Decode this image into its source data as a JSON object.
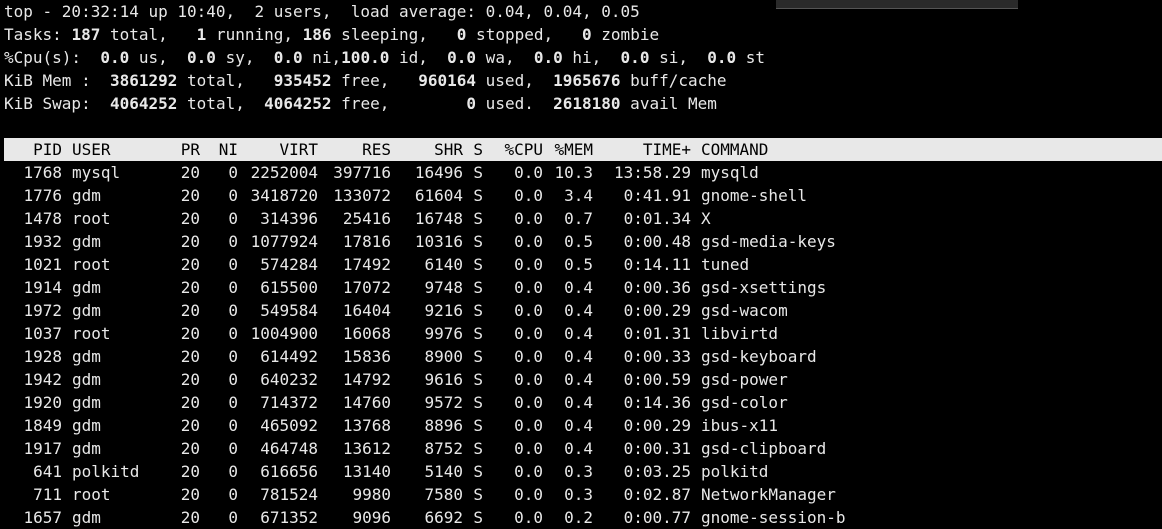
{
  "colors": {
    "background": "#000000",
    "foreground": "#e8e8e8",
    "header_bg": "#e8e8e8",
    "header_fg": "#000000"
  },
  "summary": {
    "line1": "top - 20:32:14 up 10:40,  2 users,  load average: 0.04, 0.04, 0.05",
    "tasks": {
      "prefix": "Tasks: ",
      "total": "187",
      "total_label": " total,   ",
      "running": "1",
      "running_label": " running, ",
      "sleeping": "186",
      "sleeping_label": " sleeping,   ",
      "stopped": "0",
      "stopped_label": " stopped,   ",
      "zombie": "0",
      "zombie_label": " zombie"
    },
    "cpu": {
      "prefix": "%Cpu(s): ",
      "us": " 0.0",
      "us_label": " us,  ",
      "sy": "0.0",
      "sy_label": " sy,  ",
      "ni": "0.0",
      "ni_label": " ni,",
      "id": "100.0",
      "id_label": " id,  ",
      "wa": "0.0",
      "wa_label": " wa,  ",
      "hi": "0.0",
      "hi_label": " hi,  ",
      "si": "0.0",
      "si_label": " si,  ",
      "st": "0.0",
      "st_label": " st"
    },
    "mem": {
      "prefix": "KiB Mem :  ",
      "total": "3861292",
      "total_label": " total,   ",
      "free": "935452",
      "free_label": " free,   ",
      "used": "960164",
      "used_label": " used,  ",
      "buff": "1965676",
      "buff_label": " buff/cache"
    },
    "swap": {
      "prefix": "KiB Swap:  ",
      "total": "4064252",
      "total_label": " total,  ",
      "free": "4064252",
      "free_label": " free,        ",
      "used": "0",
      "used_label": " used.  ",
      "avail": "2618180",
      "avail_label": " avail Mem"
    }
  },
  "columns": {
    "pid": "PID",
    "user": "USER",
    "pr": "PR",
    "ni": "NI",
    "virt": "VIRT",
    "res": "RES",
    "shr": "SHR",
    "s": "S",
    "cpu": "%CPU",
    "mem": "%MEM",
    "time": "TIME+",
    "command": "COMMAND"
  },
  "processes": [
    {
      "pid": "1768",
      "user": "mysql",
      "pr": "20",
      "ni": "0",
      "virt": "2252004",
      "res": "397716",
      "shr": "16496",
      "s": "S",
      "cpu": "0.0",
      "mem": "10.3",
      "time": "13:58.29",
      "command": "mysqld"
    },
    {
      "pid": "1776",
      "user": "gdm",
      "pr": "20",
      "ni": "0",
      "virt": "3418720",
      "res": "133072",
      "shr": "61604",
      "s": "S",
      "cpu": "0.0",
      "mem": "3.4",
      "time": "0:41.91",
      "command": "gnome-shell"
    },
    {
      "pid": "1478",
      "user": "root",
      "pr": "20",
      "ni": "0",
      "virt": "314396",
      "res": "25416",
      "shr": "16748",
      "s": "S",
      "cpu": "0.0",
      "mem": "0.7",
      "time": "0:01.34",
      "command": "X"
    },
    {
      "pid": "1932",
      "user": "gdm",
      "pr": "20",
      "ni": "0",
      "virt": "1077924",
      "res": "17816",
      "shr": "10316",
      "s": "S",
      "cpu": "0.0",
      "mem": "0.5",
      "time": "0:00.48",
      "command": "gsd-media-keys"
    },
    {
      "pid": "1021",
      "user": "root",
      "pr": "20",
      "ni": "0",
      "virt": "574284",
      "res": "17492",
      "shr": "6140",
      "s": "S",
      "cpu": "0.0",
      "mem": "0.5",
      "time": "0:14.11",
      "command": "tuned"
    },
    {
      "pid": "1914",
      "user": "gdm",
      "pr": "20",
      "ni": "0",
      "virt": "615500",
      "res": "17072",
      "shr": "9748",
      "s": "S",
      "cpu": "0.0",
      "mem": "0.4",
      "time": "0:00.36",
      "command": "gsd-xsettings"
    },
    {
      "pid": "1972",
      "user": "gdm",
      "pr": "20",
      "ni": "0",
      "virt": "549584",
      "res": "16404",
      "shr": "9216",
      "s": "S",
      "cpu": "0.0",
      "mem": "0.4",
      "time": "0:00.29",
      "command": "gsd-wacom"
    },
    {
      "pid": "1037",
      "user": "root",
      "pr": "20",
      "ni": "0",
      "virt": "1004900",
      "res": "16068",
      "shr": "9976",
      "s": "S",
      "cpu": "0.0",
      "mem": "0.4",
      "time": "0:01.31",
      "command": "libvirtd"
    },
    {
      "pid": "1928",
      "user": "gdm",
      "pr": "20",
      "ni": "0",
      "virt": "614492",
      "res": "15836",
      "shr": "8900",
      "s": "S",
      "cpu": "0.0",
      "mem": "0.4",
      "time": "0:00.33",
      "command": "gsd-keyboard"
    },
    {
      "pid": "1942",
      "user": "gdm",
      "pr": "20",
      "ni": "0",
      "virt": "640232",
      "res": "14792",
      "shr": "9616",
      "s": "S",
      "cpu": "0.0",
      "mem": "0.4",
      "time": "0:00.59",
      "command": "gsd-power"
    },
    {
      "pid": "1920",
      "user": "gdm",
      "pr": "20",
      "ni": "0",
      "virt": "714372",
      "res": "14760",
      "shr": "9572",
      "s": "S",
      "cpu": "0.0",
      "mem": "0.4",
      "time": "0:14.36",
      "command": "gsd-color"
    },
    {
      "pid": "1849",
      "user": "gdm",
      "pr": "20",
      "ni": "0",
      "virt": "465092",
      "res": "13768",
      "shr": "8896",
      "s": "S",
      "cpu": "0.0",
      "mem": "0.4",
      "time": "0:00.29",
      "command": "ibus-x11"
    },
    {
      "pid": "1917",
      "user": "gdm",
      "pr": "20",
      "ni": "0",
      "virt": "464748",
      "res": "13612",
      "shr": "8752",
      "s": "S",
      "cpu": "0.0",
      "mem": "0.4",
      "time": "0:00.31",
      "command": "gsd-clipboard"
    },
    {
      "pid": "641",
      "user": "polkitd",
      "pr": "20",
      "ni": "0",
      "virt": "616656",
      "res": "13140",
      "shr": "5140",
      "s": "S",
      "cpu": "0.0",
      "mem": "0.3",
      "time": "0:03.25",
      "command": "polkitd"
    },
    {
      "pid": "711",
      "user": "root",
      "pr": "20",
      "ni": "0",
      "virt": "781524",
      "res": "9980",
      "shr": "7580",
      "s": "S",
      "cpu": "0.0",
      "mem": "0.3",
      "time": "0:02.87",
      "command": "NetworkManager"
    },
    {
      "pid": "1657",
      "user": "gdm",
      "pr": "20",
      "ni": "0",
      "virt": "671352",
      "res": "9096",
      "shr": "6692",
      "s": "S",
      "cpu": "0.0",
      "mem": "0.2",
      "time": "0:00.77",
      "command": "gnome-session-b"
    }
  ]
}
